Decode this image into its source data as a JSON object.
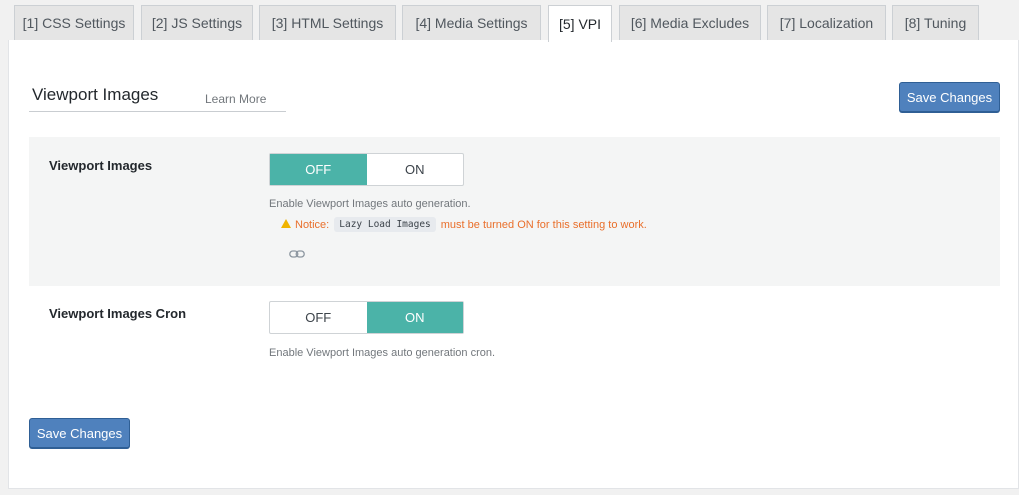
{
  "tabs": [
    {
      "label": "[1] CSS Settings"
    },
    {
      "label": "[2] JS Settings"
    },
    {
      "label": "[3] HTML Settings"
    },
    {
      "label": "[4] Media Settings"
    },
    {
      "label": "[5] VPI"
    },
    {
      "label": "[6] Media Excludes"
    },
    {
      "label": "[7] Localization"
    },
    {
      "label": "[8] Tuning"
    }
  ],
  "active_tab": "[5] VPI",
  "header": {
    "title": "Viewport Images",
    "learn_more": "Learn More",
    "save_label": "Save Changes"
  },
  "settings": [
    {
      "label": "Viewport Images",
      "off_label": "OFF",
      "on_label": "ON",
      "selected": "OFF",
      "description": "Enable Viewport Images auto generation.",
      "notice_prefix": "Notice:",
      "notice_code": "Lazy Load Images",
      "notice_suffix": "must be turned ON for this setting to work."
    },
    {
      "label": "Viewport Images Cron",
      "off_label": "OFF",
      "on_label": "ON",
      "selected": "ON",
      "description": "Enable Viewport Images auto generation cron."
    }
  ],
  "footer": {
    "save_label": "Save Changes"
  },
  "colors": {
    "accent_toggle": "#4bb3a8",
    "button_primary": "#4f81bd",
    "notice": "#e96f2b",
    "warning_icon": "#f0b400"
  },
  "icons": [
    "warning-icon",
    "link-icon"
  ]
}
